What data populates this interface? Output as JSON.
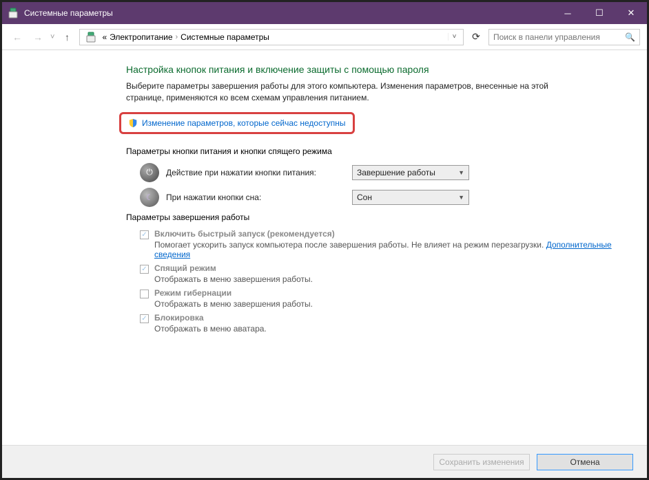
{
  "titlebar": {
    "title": "Системные параметры"
  },
  "breadcrumb": {
    "prefix": "«",
    "item1": "Электропитание",
    "item2": "Системные параметры"
  },
  "search": {
    "placeholder": "Поиск в панели управления"
  },
  "page": {
    "heading": "Настройка кнопок питания и включение защиты с помощью пароля",
    "intro": "Выберите параметры завершения работы для этого компьютера. Изменения параметров, внесенные на этой странице, применяются ко всем схемам управления питанием.",
    "change_link": "Изменение параметров, которые сейчас недоступны",
    "section_buttons": "Параметры кнопки питания и кнопки спящего режима",
    "power_button_label": "Действие при нажатии кнопки питания:",
    "power_button_value": "Завершение работы",
    "sleep_button_label": "При нажатии кнопки сна:",
    "sleep_button_value": "Сон",
    "section_shutdown": "Параметры завершения работы",
    "opts": [
      {
        "label": "Включить быстрый запуск (рекомендуется)",
        "desc_pre": "Помогает ускорить запуск компьютера после завершения работы. Не влияет на режим перезагрузки. ",
        "desc_link": "Дополнительные сведения",
        "checked": true
      },
      {
        "label": "Спящий режим",
        "desc": "Отображать в меню завершения работы.",
        "checked": true
      },
      {
        "label": "Режим гибернации",
        "desc": "Отображать в меню завершения работы.",
        "checked": false
      },
      {
        "label": "Блокировка",
        "desc": "Отображать в меню аватара.",
        "checked": true
      }
    ]
  },
  "footer": {
    "save": "Сохранить изменения",
    "cancel": "Отмена"
  }
}
